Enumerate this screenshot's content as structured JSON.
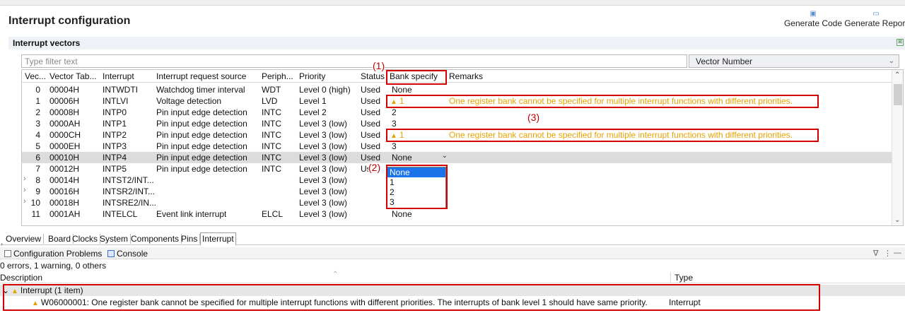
{
  "window": {
    "title": "Interrupt configuration"
  },
  "toolbar": {
    "generate_code": "Generate Code",
    "generate_report": "Generate Report"
  },
  "section": {
    "title": "Interrupt vectors"
  },
  "filter": {
    "placeholder": "Type filter text",
    "sort_by": "Vector Number"
  },
  "table": {
    "columns": [
      "Vec...",
      "Vector Tab...",
      "Interrupt",
      "Interrupt request source",
      "Periph...",
      "Priority",
      "Status",
      "Bank specify",
      "Remarks"
    ],
    "rows": [
      {
        "vec": "0",
        "addr": "00004H",
        "name": "INTWDTI",
        "source": "Watchdog timer interval",
        "periph": "WDT",
        "priority": "Level 0 (high)",
        "status": "Used",
        "bank": "None",
        "remarks": ""
      },
      {
        "vec": "1",
        "addr": "00006H",
        "name": "INTLVI",
        "source": "Voltage detection",
        "periph": "LVD",
        "priority": "Level 1",
        "status": "Used",
        "bank": "1",
        "remarks": "One register bank cannot be specified for multiple interrupt functions with different priorities."
      },
      {
        "vec": "2",
        "addr": "00008H",
        "name": "INTP0",
        "source": "Pin input edge detection",
        "periph": "INTC",
        "priority": "Level 2",
        "status": "Used",
        "bank": "2",
        "remarks": ""
      },
      {
        "vec": "3",
        "addr": "0000AH",
        "name": "INTP1",
        "source": "Pin input edge detection",
        "periph": "INTC",
        "priority": "Level 3 (low)",
        "status": "Used",
        "bank": "3",
        "remarks": ""
      },
      {
        "vec": "4",
        "addr": "0000CH",
        "name": "INTP2",
        "source": "Pin input edge detection",
        "periph": "INTC",
        "priority": "Level 3 (low)",
        "status": "Used",
        "bank": "1",
        "remarks": "One register bank cannot be specified for multiple interrupt functions with different priorities."
      },
      {
        "vec": "5",
        "addr": "0000EH",
        "name": "INTP3",
        "source": "Pin input edge detection",
        "periph": "INTC",
        "priority": "Level 3 (low)",
        "status": "Used",
        "bank": "3",
        "remarks": ""
      },
      {
        "vec": "6",
        "addr": "00010H",
        "name": "INTP4",
        "source": "Pin input edge detection",
        "periph": "INTC",
        "priority": "Level 3 (low)",
        "status": "Used",
        "bank": "None",
        "remarks": ""
      },
      {
        "vec": "7",
        "addr": "00012H",
        "name": "INTP5",
        "source": "Pin input edge detection",
        "periph": "INTC",
        "priority": "Level 3 (low)",
        "status": "Used",
        "bank": "",
        "remarks": ""
      },
      {
        "vec": "8",
        "addr": "00014H",
        "name": "INTST2/INT...",
        "source": "",
        "periph": "",
        "priority": "Level 3 (low)",
        "status": "",
        "bank": "",
        "remarks": ""
      },
      {
        "vec": "9",
        "addr": "00016H",
        "name": "INTSR2/INT...",
        "source": "",
        "periph": "",
        "priority": "Level 3 (low)",
        "status": "",
        "bank": "",
        "remarks": ""
      },
      {
        "vec": "10",
        "addr": "00018H",
        "name": "INTSRE2/IN...",
        "source": "",
        "periph": "",
        "priority": "Level 3 (low)",
        "status": "",
        "bank": "",
        "remarks": ""
      },
      {
        "vec": "11",
        "addr": "0001AH",
        "name": "INTELCL",
        "source": "Event link interrupt",
        "periph": "ELCL",
        "priority": "Level 3 (low)",
        "status": "",
        "bank": "None",
        "remarks": ""
      }
    ]
  },
  "dropdown": {
    "options": [
      "None",
      "1",
      "2",
      "3"
    ],
    "selected": "None"
  },
  "annotations": [
    "(1)",
    "(2)",
    "(3)"
  ],
  "tabs": [
    "Overview",
    "Board",
    "Clocks",
    "System",
    "Components",
    "Pins",
    "Interrupt"
  ],
  "active_tab": "Interrupt",
  "problems": {
    "tab_problems": "Configuration Problems",
    "tab_console": "Console",
    "summary": "0 errors, 1 warning, 0 others",
    "col_description": "Description",
    "col_type": "Type",
    "group": "Interrupt (1 item)",
    "item_message": "W06000001: One register bank cannot be specified for multiple interrupt functions with different priorities. The interrupts of bank level 1 should have same priority.",
    "item_type": "Interrupt"
  },
  "colors": {
    "warning": "#e8a200",
    "annotation": "#d40000",
    "selection": "#1a73e8"
  }
}
